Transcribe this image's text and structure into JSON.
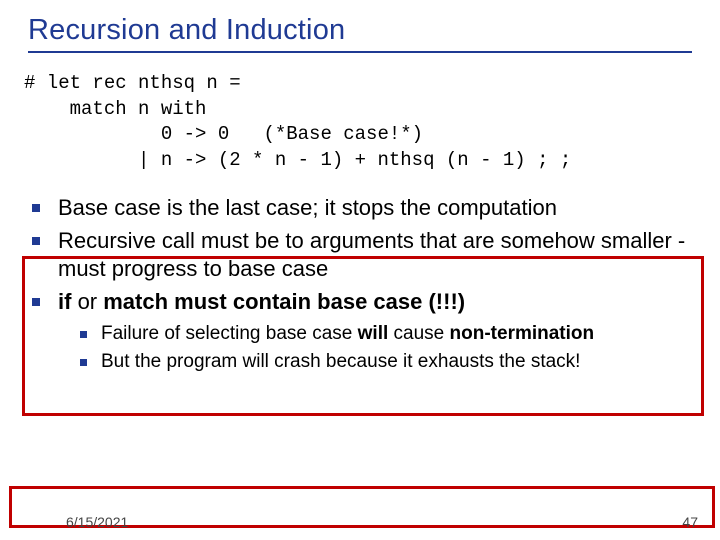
{
  "title": "Recursion and Induction",
  "code": {
    "l1": "# let rec nthsq n =",
    "l2": "    match n with",
    "l3": "            0 -> 0   (*Base case!*)",
    "l4": "          | n -> (2 * n - 1) + nthsq (n - 1) ; ;"
  },
  "bullets": {
    "b1": "Base case is the last case; it stops the computation",
    "b2": "Recursive call must be to arguments that are somehow smaller - must progress to base case",
    "b3a": "if",
    "b3b": " or ",
    "b3c": "match",
    "b3d": " must contain base case (!!!)"
  },
  "sub": {
    "s1a": "Failure of selecting base case ",
    "s1b": "will",
    "s1c": " cause ",
    "s1d": "non-termination",
    "s2": "But the program will crash because it exhausts the stack!"
  },
  "footer": {
    "date": "6/15/2021",
    "page": "47"
  }
}
